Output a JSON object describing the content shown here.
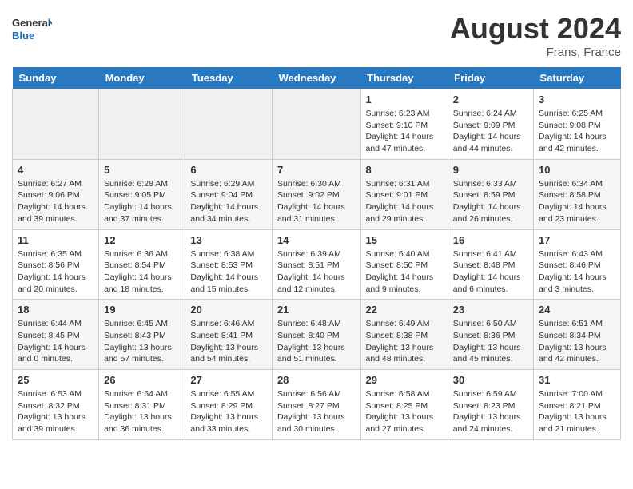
{
  "header": {
    "logo_line1": "General",
    "logo_line2": "Blue",
    "month_year": "August 2024",
    "location": "Frans, France"
  },
  "weekdays": [
    "Sunday",
    "Monday",
    "Tuesday",
    "Wednesday",
    "Thursday",
    "Friday",
    "Saturday"
  ],
  "weeks": [
    [
      {
        "day": "",
        "content": ""
      },
      {
        "day": "",
        "content": ""
      },
      {
        "day": "",
        "content": ""
      },
      {
        "day": "",
        "content": ""
      },
      {
        "day": "1",
        "content": "Sunrise: 6:23 AM\nSunset: 9:10 PM\nDaylight: 14 hours and 47 minutes."
      },
      {
        "day": "2",
        "content": "Sunrise: 6:24 AM\nSunset: 9:09 PM\nDaylight: 14 hours and 44 minutes."
      },
      {
        "day": "3",
        "content": "Sunrise: 6:25 AM\nSunset: 9:08 PM\nDaylight: 14 hours and 42 minutes."
      }
    ],
    [
      {
        "day": "4",
        "content": "Sunrise: 6:27 AM\nSunset: 9:06 PM\nDaylight: 14 hours and 39 minutes."
      },
      {
        "day": "5",
        "content": "Sunrise: 6:28 AM\nSunset: 9:05 PM\nDaylight: 14 hours and 37 minutes."
      },
      {
        "day": "6",
        "content": "Sunrise: 6:29 AM\nSunset: 9:04 PM\nDaylight: 14 hours and 34 minutes."
      },
      {
        "day": "7",
        "content": "Sunrise: 6:30 AM\nSunset: 9:02 PM\nDaylight: 14 hours and 31 minutes."
      },
      {
        "day": "8",
        "content": "Sunrise: 6:31 AM\nSunset: 9:01 PM\nDaylight: 14 hours and 29 minutes."
      },
      {
        "day": "9",
        "content": "Sunrise: 6:33 AM\nSunset: 8:59 PM\nDaylight: 14 hours and 26 minutes."
      },
      {
        "day": "10",
        "content": "Sunrise: 6:34 AM\nSunset: 8:58 PM\nDaylight: 14 hours and 23 minutes."
      }
    ],
    [
      {
        "day": "11",
        "content": "Sunrise: 6:35 AM\nSunset: 8:56 PM\nDaylight: 14 hours and 20 minutes."
      },
      {
        "day": "12",
        "content": "Sunrise: 6:36 AM\nSunset: 8:54 PM\nDaylight: 14 hours and 18 minutes."
      },
      {
        "day": "13",
        "content": "Sunrise: 6:38 AM\nSunset: 8:53 PM\nDaylight: 14 hours and 15 minutes."
      },
      {
        "day": "14",
        "content": "Sunrise: 6:39 AM\nSunset: 8:51 PM\nDaylight: 14 hours and 12 minutes."
      },
      {
        "day": "15",
        "content": "Sunrise: 6:40 AM\nSunset: 8:50 PM\nDaylight: 14 hours and 9 minutes."
      },
      {
        "day": "16",
        "content": "Sunrise: 6:41 AM\nSunset: 8:48 PM\nDaylight: 14 hours and 6 minutes."
      },
      {
        "day": "17",
        "content": "Sunrise: 6:43 AM\nSunset: 8:46 PM\nDaylight: 14 hours and 3 minutes."
      }
    ],
    [
      {
        "day": "18",
        "content": "Sunrise: 6:44 AM\nSunset: 8:45 PM\nDaylight: 14 hours and 0 minutes."
      },
      {
        "day": "19",
        "content": "Sunrise: 6:45 AM\nSunset: 8:43 PM\nDaylight: 13 hours and 57 minutes."
      },
      {
        "day": "20",
        "content": "Sunrise: 6:46 AM\nSunset: 8:41 PM\nDaylight: 13 hours and 54 minutes."
      },
      {
        "day": "21",
        "content": "Sunrise: 6:48 AM\nSunset: 8:40 PM\nDaylight: 13 hours and 51 minutes."
      },
      {
        "day": "22",
        "content": "Sunrise: 6:49 AM\nSunset: 8:38 PM\nDaylight: 13 hours and 48 minutes."
      },
      {
        "day": "23",
        "content": "Sunrise: 6:50 AM\nSunset: 8:36 PM\nDaylight: 13 hours and 45 minutes."
      },
      {
        "day": "24",
        "content": "Sunrise: 6:51 AM\nSunset: 8:34 PM\nDaylight: 13 hours and 42 minutes."
      }
    ],
    [
      {
        "day": "25",
        "content": "Sunrise: 6:53 AM\nSunset: 8:32 PM\nDaylight: 13 hours and 39 minutes."
      },
      {
        "day": "26",
        "content": "Sunrise: 6:54 AM\nSunset: 8:31 PM\nDaylight: 13 hours and 36 minutes."
      },
      {
        "day": "27",
        "content": "Sunrise: 6:55 AM\nSunset: 8:29 PM\nDaylight: 13 hours and 33 minutes."
      },
      {
        "day": "28",
        "content": "Sunrise: 6:56 AM\nSunset: 8:27 PM\nDaylight: 13 hours and 30 minutes."
      },
      {
        "day": "29",
        "content": "Sunrise: 6:58 AM\nSunset: 8:25 PM\nDaylight: 13 hours and 27 minutes."
      },
      {
        "day": "30",
        "content": "Sunrise: 6:59 AM\nSunset: 8:23 PM\nDaylight: 13 hours and 24 minutes."
      },
      {
        "day": "31",
        "content": "Sunrise: 7:00 AM\nSunset: 8:21 PM\nDaylight: 13 hours and 21 minutes."
      }
    ]
  ]
}
